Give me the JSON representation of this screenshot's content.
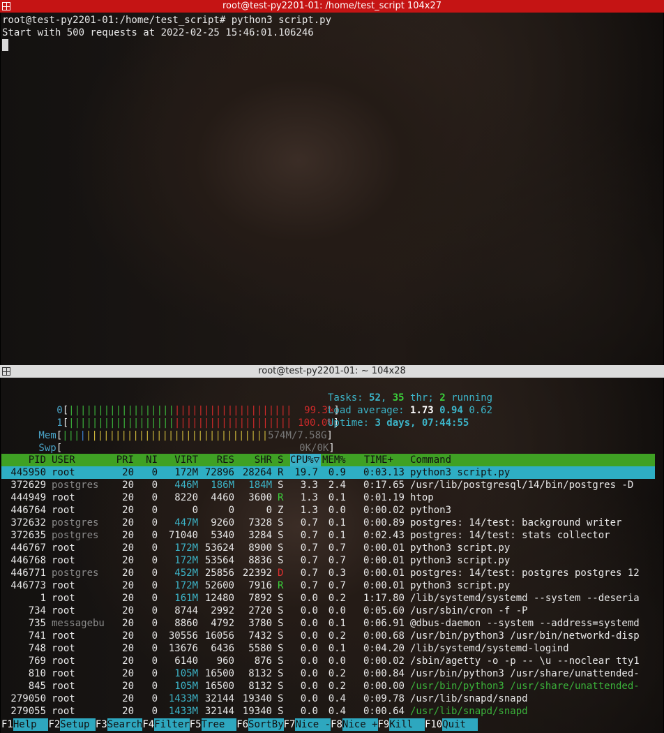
{
  "top_window": {
    "title": "root@test-py2201-01: /home/test_script 104x27",
    "lines": [
      "root@test-py2201-01:/home/test_script# python3 script.py",
      "Start with 500 requests at 2022-02-25 15:46:01.106246"
    ]
  },
  "bottom_window": {
    "title": "root@test-py2201-01: ~ 104x28"
  },
  "meters": {
    "cpu0": {
      "label": "0",
      "value": "99.3%",
      "fraction": 0.993
    },
    "cpu1": {
      "label": "1",
      "value": "100.0%",
      "fraction": 1.0
    },
    "mem": {
      "label": "Mem",
      "value": "574M/7.58G"
    },
    "swp": {
      "label": "Swp",
      "value": "0K/0K"
    }
  },
  "stats": {
    "tasks_label": "Tasks:",
    "tasks": "52",
    "thr": "35",
    "thr_label": "thr;",
    "running": "2",
    "running_label": "running",
    "load_label": "Load average:",
    "load1": "1.73",
    "load5": "0.94",
    "load15": "0.62",
    "uptime_label": "Uptime:",
    "uptime": "3 days, 07:44:55"
  },
  "table": {
    "headers": {
      "pid": "PID",
      "user": "USER",
      "pri": "PRI",
      "ni": "NI",
      "virt": "VIRT",
      "res": "RES",
      "shr": "SHR",
      "s": "S",
      "cpu": "CPU%▽",
      "mem": "MEM%",
      "time": "TIME+",
      "command": "Command"
    },
    "rows": [
      {
        "pid": "445950",
        "user": "root",
        "pri": "20",
        "ni": "0",
        "virt": "172M",
        "res": "72896",
        "shr": "28264",
        "s": "R",
        "cpu": "19.7",
        "mem": "0.9",
        "time": "0:03.13",
        "command": "python3 script.py"
      },
      {
        "pid": "372629",
        "user": "postgres",
        "pri": "20",
        "ni": "0",
        "virt": "446M",
        "res": "186M",
        "shr": "184M",
        "s": "S",
        "cpu": "3.3",
        "mem": "2.4",
        "time": "0:17.65",
        "command": "/usr/lib/postgresql/14/bin/postgres -D"
      },
      {
        "pid": "444949",
        "user": "root",
        "pri": "20",
        "ni": "0",
        "virt": "8220",
        "res": "4460",
        "shr": "3600",
        "s": "R",
        "cpu": "1.3",
        "mem": "0.1",
        "time": "0:01.19",
        "command": "htop"
      },
      {
        "pid": "446764",
        "user": "root",
        "pri": "20",
        "ni": "0",
        "virt": "0",
        "res": "0",
        "shr": "0",
        "s": "Z",
        "cpu": "1.3",
        "mem": "0.0",
        "time": "0:00.02",
        "command": "python3"
      },
      {
        "pid": "372632",
        "user": "postgres",
        "pri": "20",
        "ni": "0",
        "virt": "447M",
        "res": "9260",
        "shr": "7328",
        "s": "S",
        "cpu": "0.7",
        "mem": "0.1",
        "time": "0:00.89",
        "command": "postgres: 14/test: background writer"
      },
      {
        "pid": "372635",
        "user": "postgres",
        "pri": "20",
        "ni": "0",
        "virt": "71040",
        "res": "5340",
        "shr": "3284",
        "s": "S",
        "cpu": "0.7",
        "mem": "0.1",
        "time": "0:02.43",
        "command": "postgres: 14/test: stats collector"
      },
      {
        "pid": "446767",
        "user": "root",
        "pri": "20",
        "ni": "0",
        "virt": "172M",
        "res": "53624",
        "shr": "8900",
        "s": "S",
        "cpu": "0.7",
        "mem": "0.7",
        "time": "0:00.01",
        "command": "python3 script.py"
      },
      {
        "pid": "446768",
        "user": "root",
        "pri": "20",
        "ni": "0",
        "virt": "172M",
        "res": "53564",
        "shr": "8836",
        "s": "S",
        "cpu": "0.7",
        "mem": "0.7",
        "time": "0:00.01",
        "command": "python3 script.py"
      },
      {
        "pid": "446771",
        "user": "postgres",
        "pri": "20",
        "ni": "0",
        "virt": "452M",
        "res": "25856",
        "shr": "22392",
        "s": "D",
        "cpu": "0.7",
        "mem": "0.3",
        "time": "0:00.01",
        "command": "postgres: 14/test: postgres postgres 12"
      },
      {
        "pid": "446773",
        "user": "root",
        "pri": "20",
        "ni": "0",
        "virt": "172M",
        "res": "52600",
        "shr": "7916",
        "s": "R",
        "cpu": "0.7",
        "mem": "0.7",
        "time": "0:00.01",
        "command": "python3 script.py"
      },
      {
        "pid": "1",
        "user": "root",
        "pri": "20",
        "ni": "0",
        "virt": "161M",
        "res": "12480",
        "shr": "7892",
        "s": "S",
        "cpu": "0.0",
        "mem": "0.2",
        "time": "1:17.80",
        "command": "/lib/systemd/systemd --system --deseria"
      },
      {
        "pid": "734",
        "user": "root",
        "pri": "20",
        "ni": "0",
        "virt": "8744",
        "res": "2992",
        "shr": "2720",
        "s": "S",
        "cpu": "0.0",
        "mem": "0.0",
        "time": "0:05.60",
        "command": "/usr/sbin/cron -f -P"
      },
      {
        "pid": "735",
        "user": "messagebu",
        "pri": "20",
        "ni": "0",
        "virt": "8860",
        "res": "4792",
        "shr": "3780",
        "s": "S",
        "cpu": "0.0",
        "mem": "0.1",
        "time": "0:06.91",
        "command": "@dbus-daemon --system --address=systemd"
      },
      {
        "pid": "741",
        "user": "root",
        "pri": "20",
        "ni": "0",
        "virt": "30556",
        "res": "16056",
        "shr": "7432",
        "s": "S",
        "cpu": "0.0",
        "mem": "0.2",
        "time": "0:00.68",
        "command": "/usr/bin/python3 /usr/bin/networkd-disp"
      },
      {
        "pid": "748",
        "user": "root",
        "pri": "20",
        "ni": "0",
        "virt": "13676",
        "res": "6436",
        "shr": "5580",
        "s": "S",
        "cpu": "0.0",
        "mem": "0.1",
        "time": "0:04.20",
        "command": "/lib/systemd/systemd-logind"
      },
      {
        "pid": "769",
        "user": "root",
        "pri": "20",
        "ni": "0",
        "virt": "6140",
        "res": "960",
        "shr": "876",
        "s": "S",
        "cpu": "0.0",
        "mem": "0.0",
        "time": "0:00.02",
        "command": "/sbin/agetty -o -p -- \\u --noclear tty1"
      },
      {
        "pid": "810",
        "user": "root",
        "pri": "20",
        "ni": "0",
        "virt": "105M",
        "res": "16500",
        "shr": "8132",
        "s": "S",
        "cpu": "0.0",
        "mem": "0.2",
        "time": "0:00.84",
        "command": "/usr/bin/python3 /usr/share/unattended-"
      },
      {
        "pid": "845",
        "user": "root",
        "pri": "20",
        "ni": "0",
        "virt": "105M",
        "res": "16500",
        "shr": "8132",
        "s": "S",
        "cpu": "0.0",
        "mem": "0.2",
        "time": "0:00.00",
        "command": "/usr/bin/python3 /usr/share/unattended-"
      },
      {
        "pid": "279050",
        "user": "root",
        "pri": "20",
        "ni": "0",
        "virt": "1433M",
        "res": "32144",
        "shr": "19340",
        "s": "S",
        "cpu": "0.0",
        "mem": "0.4",
        "time": "0:09.78",
        "command": "/usr/lib/snapd/snapd"
      },
      {
        "pid": "279055",
        "user": "root",
        "pri": "20",
        "ni": "0",
        "virt": "1433M",
        "res": "32144",
        "shr": "19340",
        "s": "S",
        "cpu": "0.0",
        "mem": "0.4",
        "time": "0:00.64",
        "command": "/usr/lib/snapd/snapd"
      }
    ]
  },
  "function_keys": [
    {
      "key": "F1",
      "label": "Help  "
    },
    {
      "key": "F2",
      "label": "Setup "
    },
    {
      "key": "F3",
      "label": "Search"
    },
    {
      "key": "F4",
      "label": "Filter"
    },
    {
      "key": "F5",
      "label": "Tree  "
    },
    {
      "key": "F6",
      "label": "SortBy"
    },
    {
      "key": "F7",
      "label": "Nice -"
    },
    {
      "key": "F8",
      "label": "Nice +"
    },
    {
      "key": "F9",
      "label": "Kill  "
    },
    {
      "key": "F10",
      "label": "Quit  "
    }
  ],
  "colors": {
    "top_titlebar": "#c51414",
    "header_row": "#3fa124",
    "selected_row": "#2eaec4",
    "sort_column": "#3ab0c6"
  }
}
